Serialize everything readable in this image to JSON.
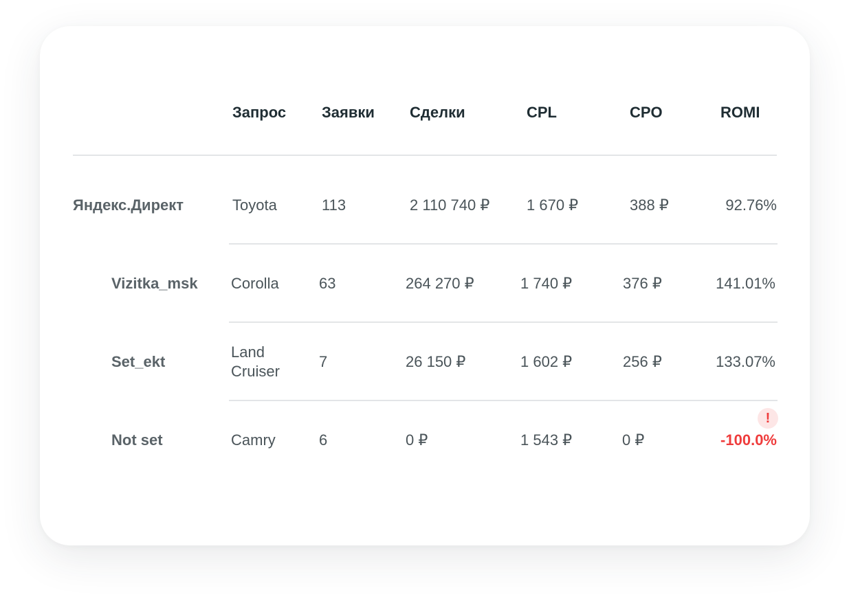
{
  "headers": {
    "query": "Запрос",
    "leads": "Заявки",
    "deals": "Сделки",
    "cpl": "CPL",
    "cpo": "CPO",
    "romi": "ROMI"
  },
  "rows": [
    {
      "source": "Яндекс.Директ",
      "query": "Toyota",
      "leads": "113",
      "deals": "2 110 740 ₽",
      "cpl": "1 670 ₽",
      "cpo": "388 ₽",
      "romi": "92.76%"
    },
    {
      "source": "Vizitka_msk",
      "query": "Corolla",
      "leads": "63",
      "deals": "264 270 ₽",
      "cpl": "1 740 ₽",
      "cpo": "376 ₽",
      "romi": "141.01%"
    },
    {
      "source": "Set_ekt",
      "query_line1": "Land",
      "query_line2": "Cruiser",
      "leads": "7",
      "deals": "26 150 ₽",
      "cpl": "1 602 ₽",
      "cpo": "256 ₽",
      "romi": "133.07%"
    },
    {
      "source": "Not set",
      "query": "Camry",
      "leads": "6",
      "deals": "0 ₽",
      "cpl": "1 543 ₽",
      "cpo": "0 ₽",
      "romi": "-100.0%"
    }
  ],
  "warning_icon": "!",
  "colors": {
    "negative": "#ef3c3c",
    "warning_bg": "#fde6e6",
    "header_text": "#1f2d33",
    "body_text": "#4a5459"
  }
}
